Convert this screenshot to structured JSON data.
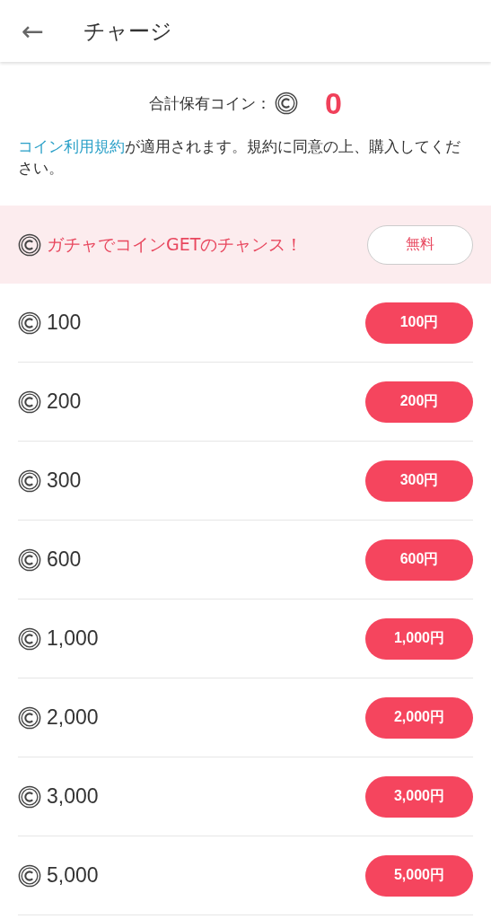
{
  "header": {
    "back": "←",
    "title": "チャージ"
  },
  "balance": {
    "label": "合計保有コイン：",
    "value": "0"
  },
  "notice": {
    "link": "コイン利用規約",
    "text": "が適用されます。規約に同意の上、購入してください。"
  },
  "gacha": {
    "text": "ガチャでコインGETのチャンス！",
    "button": "無料"
  },
  "packs": [
    {
      "coins": "100",
      "price": "100円"
    },
    {
      "coins": "200",
      "price": "200円"
    },
    {
      "coins": "300",
      "price": "300円"
    },
    {
      "coins": "600",
      "price": "600円"
    },
    {
      "coins": "1,000",
      "price": "1,000円"
    },
    {
      "coins": "2,000",
      "price": "2,000円"
    },
    {
      "coins": "3,000",
      "price": "3,000円"
    },
    {
      "coins": "5,000",
      "price": "5,000円"
    }
  ]
}
